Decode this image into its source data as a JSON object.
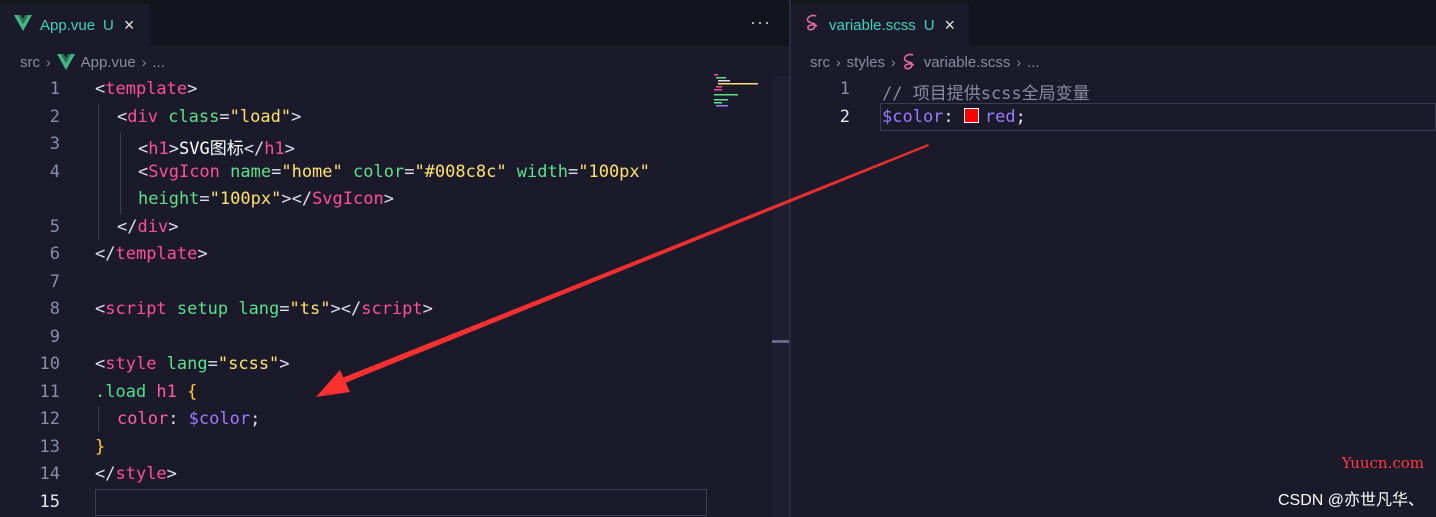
{
  "left_editor": {
    "tab": {
      "filename": "App.vue",
      "status": "U",
      "close": "×"
    },
    "more_actions": "···",
    "breadcrumb": {
      "folder": "src",
      "file": "App.vue",
      "tail": "..."
    },
    "line_numbers": [
      "1",
      "2",
      "3",
      "4",
      "5",
      "6",
      "7",
      "8",
      "9",
      "10",
      "11",
      "12",
      "13",
      "14",
      "15"
    ],
    "code": {
      "l1_open": "<",
      "l1_tag": "template",
      "l1_close": ">",
      "l2_open": "<",
      "l2_tag": "div",
      "l2_attr": " class",
      "l2_eq": "=",
      "l2_val": "\"load\"",
      "l2_close": ">",
      "l3_open": "<",
      "l3_tag": "h1",
      "l3_close": ">",
      "l3_text": "SVG图标",
      "l3_end_open": "</",
      "l3_end_tag": "h1",
      "l3_end_close": ">",
      "l4_open": "<",
      "l4_tag": "SvgIcon",
      "l4_attr1": " name",
      "l4_eq1": "=",
      "l4_val1": "\"home\"",
      "l4_attr2": " color",
      "l4_eq2": "=",
      "l4_val2": "\"#008c8c\"",
      "l4_attr3": " width",
      "l4_eq3": "=",
      "l4_val3": "\"100px\"",
      "l4b_attr": "height",
      "l4b_eq": "=",
      "l4b_val": "\"100px\"",
      "l4b_close": ">",
      "l4b_end_open": "</",
      "l4b_end_tag": "SvgIcon",
      "l4b_end_close": ">",
      "l5_open": "</",
      "l5_tag": "div",
      "l5_close": ">",
      "l6_open": "</",
      "l6_tag": "template",
      "l6_close": ">",
      "l8_open": "<",
      "l8_tag": "script",
      "l8_attr1": " setup",
      "l8_attr2": " lang",
      "l8_eq": "=",
      "l8_val": "\"ts\"",
      "l8_close": ">",
      "l8_end_open": "</",
      "l8_end_tag": "script",
      "l8_end_close": ">",
      "l10_open": "<",
      "l10_tag": "style",
      "l10_attr": " lang",
      "l10_eq": "=",
      "l10_val": "\"scss\"",
      "l10_close": ">",
      "l11_sel": ".load",
      "l11_tag": " h1",
      "l11_brace": " {",
      "l12_prop": "color",
      "l12_colon": ": ",
      "l12_var": "$color",
      "l12_semi": ";",
      "l13_brace": "}",
      "l14_open": "</",
      "l14_tag": "style",
      "l14_close": ">"
    }
  },
  "right_editor": {
    "tab": {
      "filename": "variable.scss",
      "status": "U",
      "close": "×"
    },
    "breadcrumb": {
      "folder": "src",
      "subfolder": "styles",
      "file": "variable.scss",
      "tail": "..."
    },
    "line_numbers": [
      "1",
      "2"
    ],
    "code": {
      "l1_comment": "// 项目提供scss全局变量",
      "l2_var": "$color",
      "l2_colon": ": ",
      "l2_value": "red",
      "l2_semi": ";"
    }
  },
  "watermarks": {
    "site": "Yuucn.com",
    "author": "CSDN @亦世凡华、"
  },
  "colors": {
    "background": "#1a1a2b",
    "tag": "#ff4f9a",
    "attr": "#5fe08a",
    "string": "#ffe26b",
    "arrow": "#ff3030",
    "tab_accent": "#3fd3c3"
  },
  "icons": {
    "vue": "vue-logo-icon",
    "sass": "sass-icon"
  }
}
